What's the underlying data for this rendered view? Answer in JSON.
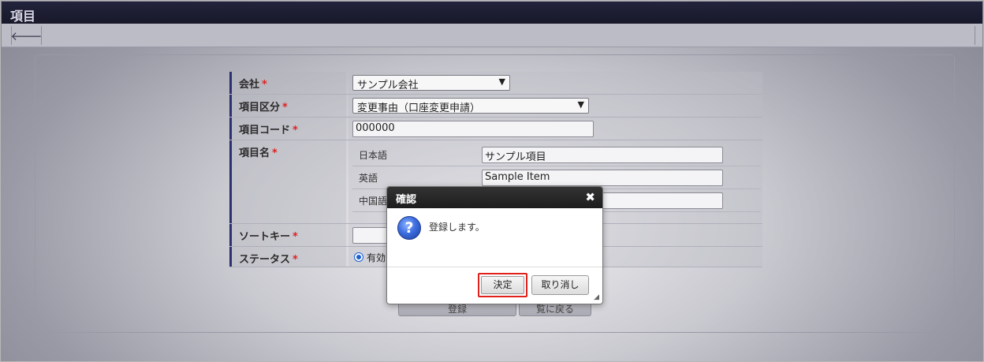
{
  "window": {
    "title": "項目"
  },
  "toolbar": {
    "back_icon": "arrow-left-icon",
    "back_glyph": "🡐"
  },
  "form": {
    "company": {
      "label": "会社",
      "required": "*",
      "value": "サンプル会社"
    },
    "category": {
      "label": "項目区分",
      "required": "*",
      "value": "変更事由（口座変更申請）"
    },
    "code": {
      "label": "項目コード",
      "required": "*",
      "value": "000000"
    },
    "name": {
      "label": "項目名",
      "required": "*",
      "languages": [
        {
          "label": "日本語",
          "value": "サンプル項目"
        },
        {
          "label": "英語",
          "value": "Sample Item"
        },
        {
          "label": "中国語",
          "value": ""
        }
      ]
    },
    "sort_key": {
      "label": "ソートキー",
      "required": "*",
      "value": ""
    },
    "status": {
      "label": "ステータス",
      "required": "*",
      "option_label": "有効"
    }
  },
  "buttons": {
    "register": "登録",
    "back_to_list": "覧に戻る"
  },
  "dialog": {
    "title": "確認",
    "message": "登録します。",
    "ok_label": "決定",
    "cancel_label": "取り消し",
    "close_glyph": "✖",
    "icon_glyph": "?"
  },
  "colors": {
    "required": "#dd2222",
    "highlight": "#e0201a",
    "header": "#171829"
  }
}
